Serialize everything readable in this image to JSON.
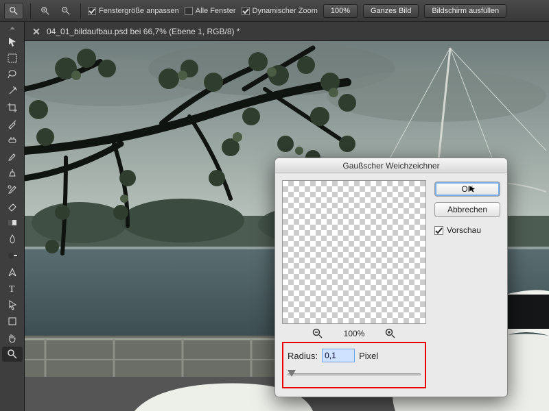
{
  "optionBar": {
    "checks": {
      "resizeToFit": {
        "label": "Fenstergröße anpassen",
        "checked": true
      },
      "allWindows": {
        "label": "Alle Fenster",
        "checked": false
      },
      "scrubbyZoom": {
        "label": "Dynamischer Zoom",
        "checked": true
      }
    },
    "buttons": {
      "hundred": "100%",
      "fitScreen": "Ganzes Bild",
      "fillScreen": "Bildschirm ausfüllen"
    }
  },
  "document": {
    "title": "04_01_bildaufbau.psd bei 66,7% (Ebene 1, RGB/8) *"
  },
  "dialog": {
    "title": "Gaußscher Weichzeichner",
    "okLabel": "OK",
    "cancelLabel": "Abbrechen",
    "previewLabel": "Vorschau",
    "previewChecked": true,
    "zoomLabel": "100%",
    "radiusLabel": "Radius:",
    "radiusValue": "0,1",
    "radiusUnit": "Pixel"
  }
}
